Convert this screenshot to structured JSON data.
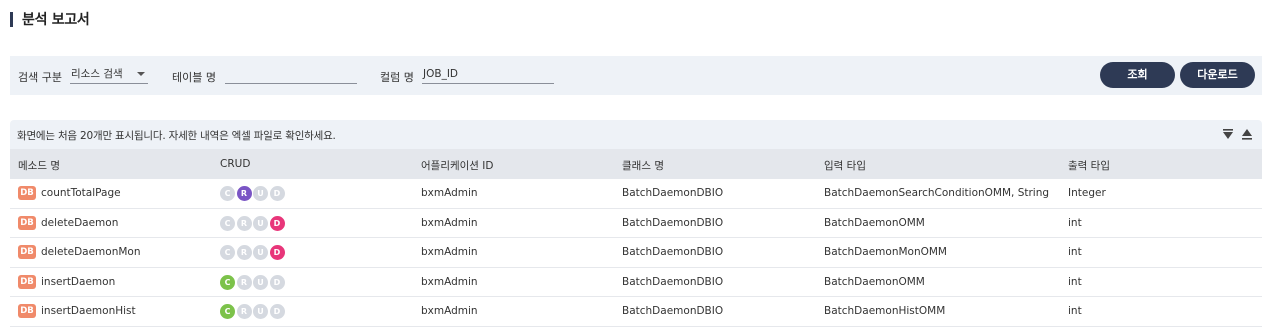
{
  "page": {
    "title": "분석 보고서"
  },
  "search": {
    "category_label": "검색 구분",
    "category_value": "리소스 검색",
    "table_label": "테이블 명",
    "table_value": "",
    "column_label": "컬럼 명",
    "column_value": "JOB_ID",
    "query_button": "조회",
    "download_button": "다운로드"
  },
  "notice": {
    "message": "화면에는 처음 20개만 표시됩니다. 자세한 내역은 엑셀 파일로 확인하세요."
  },
  "colors": {
    "create": "#7cc24a",
    "read": "#7a55c5",
    "update": "#d5d9e0",
    "delete": "#e8367a",
    "inactive": "#d5d9e0",
    "db_badge": "#f08a6a",
    "button": "#2e3a55"
  },
  "table": {
    "headers": [
      "메소드 명",
      "CRUD",
      "어플리케이션 ID",
      "클래스 명",
      "입력 타입",
      "출력 타입"
    ],
    "badge_label": "DB",
    "crud_letters": [
      "C",
      "R",
      "U",
      "D"
    ],
    "rows": [
      {
        "method": "countTotalPage",
        "crud_active": [
          false,
          true,
          false,
          false
        ],
        "app_id": "bxmAdmin",
        "class_name": "BatchDaemonDBIO",
        "input_type": "BatchDaemonSearchConditionOMM, String",
        "output_type": "Integer"
      },
      {
        "method": "deleteDaemon",
        "crud_active": [
          false,
          false,
          false,
          true
        ],
        "app_id": "bxmAdmin",
        "class_name": "BatchDaemonDBIO",
        "input_type": "BatchDaemonOMM",
        "output_type": "int"
      },
      {
        "method": "deleteDaemonMon",
        "crud_active": [
          false,
          false,
          false,
          true
        ],
        "app_id": "bxmAdmin",
        "class_name": "BatchDaemonDBIO",
        "input_type": "BatchDaemonMonOMM",
        "output_type": "int"
      },
      {
        "method": "insertDaemon",
        "crud_active": [
          true,
          false,
          false,
          false
        ],
        "app_id": "bxmAdmin",
        "class_name": "BatchDaemonDBIO",
        "input_type": "BatchDaemonOMM",
        "output_type": "int"
      },
      {
        "method": "insertDaemonHist",
        "crud_active": [
          true,
          false,
          false,
          false
        ],
        "app_id": "bxmAdmin",
        "class_name": "BatchDaemonDBIO",
        "input_type": "BatchDaemonHistOMM",
        "output_type": "int"
      }
    ]
  }
}
